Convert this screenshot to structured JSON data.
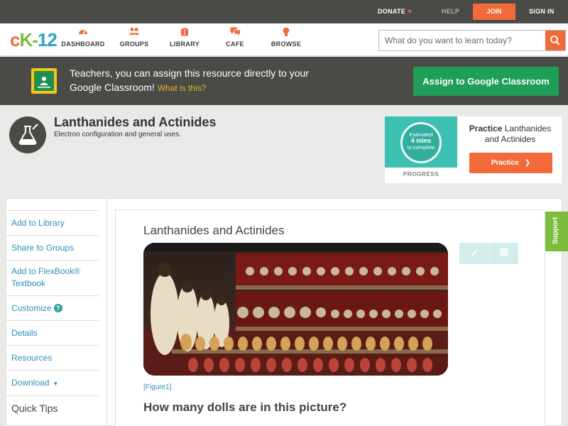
{
  "topbar": {
    "donate": "DONATE",
    "help": "HELP",
    "join": "JOIN",
    "signin": "SIGN IN"
  },
  "nav": {
    "logo": {
      "c": "c",
      "k": "K-",
      "n": "12"
    },
    "items": [
      {
        "label": "DASHBOARD",
        "icon": "dashboard-icon"
      },
      {
        "label": "GROUPS",
        "icon": "groups-icon"
      },
      {
        "label": "LIBRARY",
        "icon": "library-icon"
      },
      {
        "label": "CAFE",
        "icon": "cafe-icon"
      },
      {
        "label": "BROWSE",
        "icon": "browse-icon"
      }
    ],
    "search_placeholder": "What do you want to learn today?"
  },
  "gbanner": {
    "text": "Teachers, you can assign this resource directly to your Google Classroom!",
    "what": "What is this?",
    "button": "Assign to Google Classroom"
  },
  "header": {
    "title": "Lanthanides and Actinides",
    "subtitle": "Electron configuration and general uses."
  },
  "practice": {
    "badge": {
      "l1": "Estimated",
      "l2": "4 mins",
      "l3": "to complete"
    },
    "progress": "PROGRESS",
    "label_bold": "Practice",
    "label_rest": "Lanthanides and Actinides",
    "button": "Practice"
  },
  "sidebar": {
    "items": [
      "Add to Library",
      "Share to Groups",
      "Add to FlexBook® Textbook",
      "Customize",
      "Details",
      "Resources",
      "Download",
      "Quick Tips"
    ]
  },
  "content": {
    "title": "Lanthanides and Actinides",
    "figcaption": "[Figure1]",
    "question": "How many dolls are in this picture?"
  },
  "support": "Support",
  "colors": {
    "accent": "#f26a3a",
    "green": "#1e9e56",
    "link": "#2e8fb5",
    "teal": "#3dbfb1",
    "dark": "#4a4a47"
  }
}
